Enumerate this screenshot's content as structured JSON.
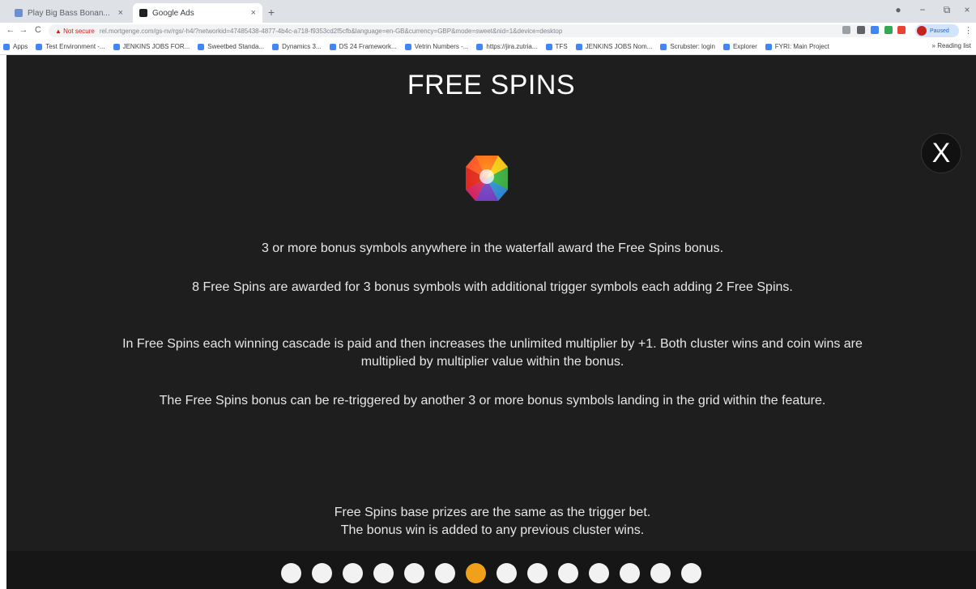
{
  "browser": {
    "tabs": [
      {
        "label": "Play Big Bass Bonan..."
      },
      {
        "label": "Google Ads"
      }
    ],
    "new_tab": "+",
    "window_controls": [
      "●",
      "−",
      "⧉",
      "×"
    ],
    "nav": {
      "back": "←",
      "forward": "→",
      "reload": "C"
    },
    "address": {
      "security": "▲ Not secure",
      "url": "rel.mortgenge.com/gs-nv/rgs/-h4/?networkid=47485438-4877-4b4c-a718-f9353cd2f5cfb&language=en-GB&currency=GBP&mode=sweet&nid=1&device=desktop"
    },
    "profile": {
      "label": "Paused"
    },
    "menu": "⋮",
    "bookmarks": [
      {
        "label": "Apps"
      },
      {
        "label": "Test Environment -..."
      },
      {
        "label": "JENKINS JOBS FOR..."
      },
      {
        "label": "Sweetbed Standa..."
      },
      {
        "label": "Dynamics 3..."
      },
      {
        "label": "DS 24 Framework..."
      },
      {
        "label": "Vetrin Numbers -..."
      },
      {
        "label": "https://jira.zutria..."
      },
      {
        "label": "TFS"
      },
      {
        "label": "JENKINS JOBS Nom..."
      },
      {
        "label": "Scrubster: login"
      },
      {
        "label": "Explorer"
      },
      {
        "label": "FYRI: Main Project"
      }
    ],
    "bookmarks_end": "» Reading list"
  },
  "panel": {
    "title": "FREE SPINS",
    "close_label": "X",
    "paragraphs": [
      "3 or more bonus symbols anywhere in the waterfall award the Free Spins bonus.",
      "8 Free Spins are awarded for 3 bonus symbols with additional trigger symbols each adding 2 Free Spins.",
      "In Free Spins each winning cascade is paid and then increases the unlimited multiplier by +1. Both cluster wins and coin wins are multiplied by multiplier value within the bonus.",
      "The Free Spins bonus can be re-triggered by another 3 or more bonus symbols landing in the grid within the feature.",
      "Free Spins base prizes are the same as the trigger bet.",
      "The bonus win is added to any previous cluster wins."
    ]
  },
  "pagination": {
    "total_pages": 14,
    "current_page": 7,
    "active_color": "#f0a11a",
    "dot_color": "#f2f2f2"
  },
  "icons": {
    "bonus_symbol": "rainbow-gem-icon"
  }
}
